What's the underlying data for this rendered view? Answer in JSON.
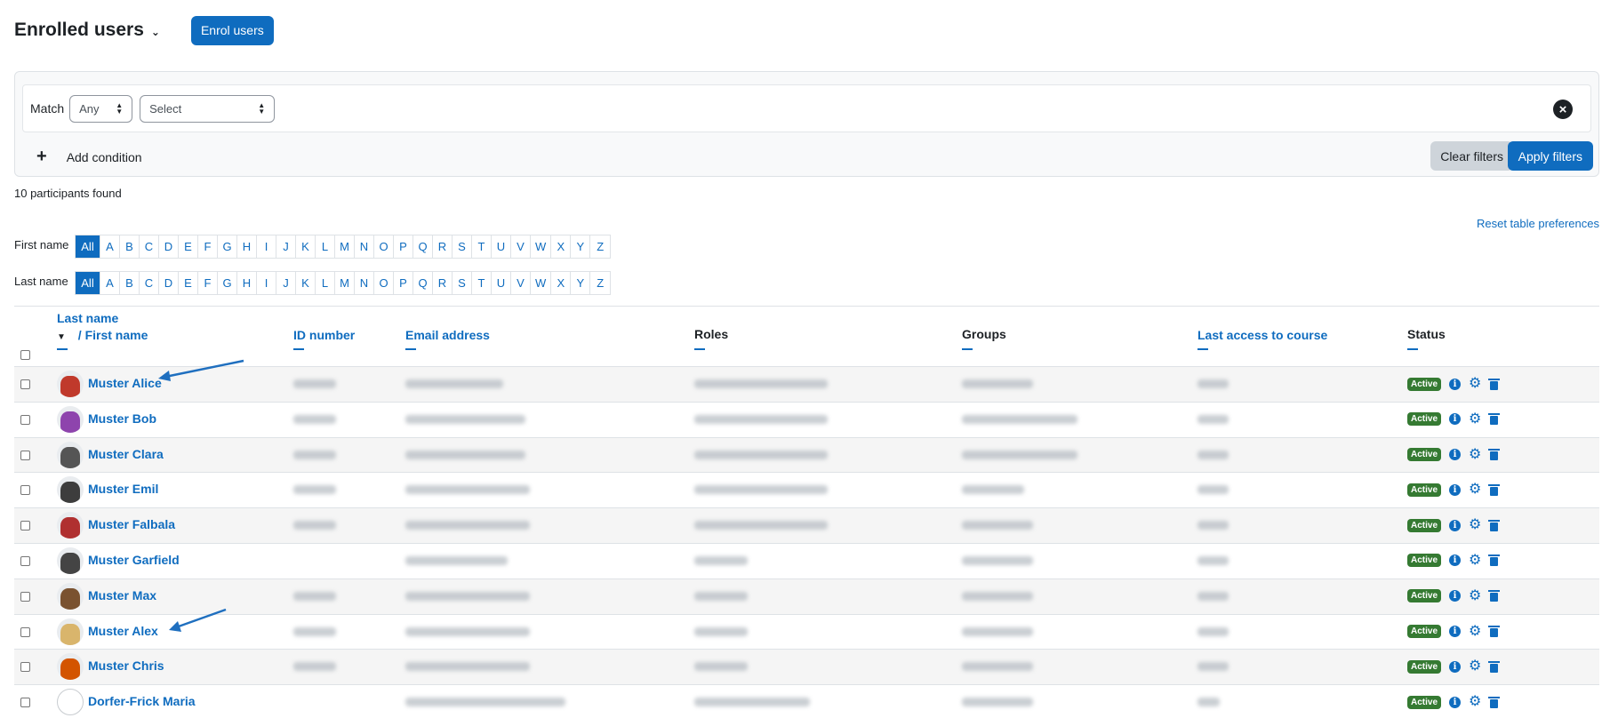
{
  "header": {
    "title": "Enrolled users",
    "enrol_button": "Enrol users"
  },
  "filters": {
    "match_label": "Match",
    "match_value": "Any",
    "field_value": "Select",
    "remove_icon": "close-icon",
    "add_condition": "Add condition",
    "clear_filters": "Clear filters",
    "apply_filters": "Apply filters"
  },
  "summary": {
    "participants_found": "10 participants found",
    "reset_preferences": "Reset table preferences"
  },
  "initials": {
    "first_label": "First name",
    "last_label": "Last name",
    "letters": [
      "All",
      "A",
      "B",
      "C",
      "D",
      "E",
      "F",
      "G",
      "H",
      "I",
      "J",
      "K",
      "L",
      "M",
      "N",
      "O",
      "P",
      "Q",
      "R",
      "S",
      "T",
      "U",
      "V",
      "W",
      "X",
      "Y",
      "Z"
    ],
    "active": "All"
  },
  "columns": {
    "last_name": "Last name",
    "first_name": "/ First name",
    "id_number": "ID number",
    "email": "Email address",
    "roles": "Roles",
    "groups": "Groups",
    "last_access": "Last access to course",
    "status": "Status"
  },
  "rows": [
    {
      "name": "Muster Alice",
      "status": "Active"
    },
    {
      "name": "Muster Bob",
      "status": "Active"
    },
    {
      "name": "Muster Clara",
      "status": "Active"
    },
    {
      "name": "Muster Emil",
      "status": "Active"
    },
    {
      "name": "Muster Falbala",
      "status": "Active"
    },
    {
      "name": "Muster Garfield",
      "status": "Active"
    },
    {
      "name": "Muster Max",
      "status": "Active"
    },
    {
      "name": "Muster Alex",
      "status": "Active"
    },
    {
      "name": "Muster Chris",
      "status": "Active"
    },
    {
      "name": "Dorfer-Frick Maria",
      "status": "Active"
    }
  ],
  "colors": {
    "primary": "#0f6cbf",
    "active_badge": "#357a32",
    "annotation_arrow": "#1f6fbf"
  }
}
